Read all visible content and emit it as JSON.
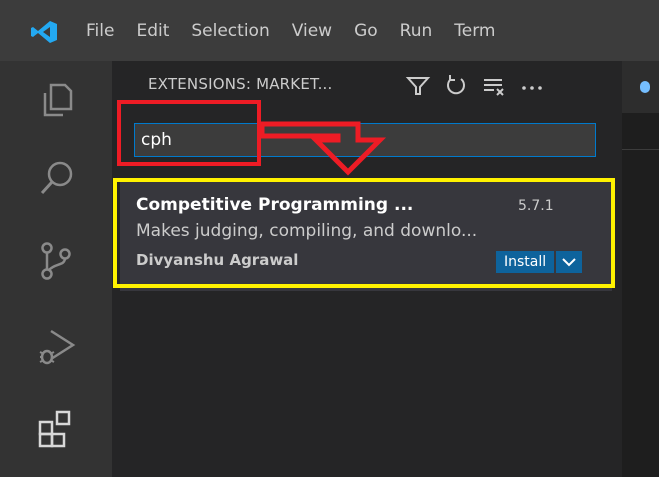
{
  "menu": [
    "File",
    "Edit",
    "Selection",
    "View",
    "Go",
    "Run",
    "Term"
  ],
  "sidebar": {
    "title": "EXTENSIONS: MARKET...",
    "actions": [
      "filter-icon",
      "refresh-icon",
      "clear-results-icon",
      "more-actions-icon"
    ]
  },
  "search": {
    "value": "cph"
  },
  "extension": {
    "name": "Competitive Programming ...",
    "version": "5.7.1",
    "description": "Makes judging, compiling, and downlo...",
    "publisher": "Divyanshu Agrawal",
    "install_label": "Install"
  },
  "activity_bar": [
    "explorer-icon",
    "search-icon",
    "source-control-icon",
    "run-debug-icon",
    "extensions-icon"
  ],
  "colors": {
    "accent": "#007acc",
    "install_button": "#0e639c",
    "annotation_red": "#ee1c25",
    "annotation_yellow": "#fff200"
  }
}
